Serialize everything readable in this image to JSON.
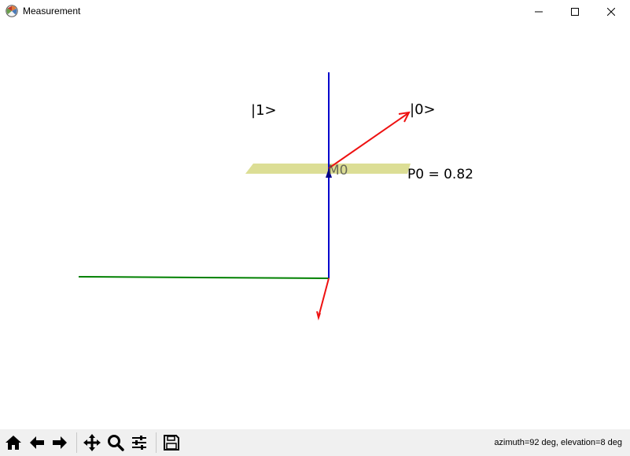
{
  "window": {
    "title": "Measurement",
    "icon": "matplotlib-icon"
  },
  "plot": {
    "labels": {
      "ket_one": "|1>",
      "ket_zero": "|0>",
      "measurement_label": "M0",
      "probability": "P0 = 0.82"
    },
    "colors": {
      "z_axis": "#0000cc",
      "x_axis": "#008000",
      "state_vector": "#ee1111",
      "measurement_plane": "#d8da8a"
    },
    "view": {
      "azimuth_deg": 92,
      "elevation_deg": 8
    }
  },
  "toolbar": {
    "buttons": [
      {
        "name": "home",
        "icon": "home-icon"
      },
      {
        "name": "back",
        "icon": "back-arrow-icon"
      },
      {
        "name": "forward",
        "icon": "forward-arrow-icon"
      },
      {
        "name": "pan",
        "icon": "pan-icon"
      },
      {
        "name": "zoom",
        "icon": "zoom-icon"
      },
      {
        "name": "configure",
        "icon": "configure-subplots-icon"
      },
      {
        "name": "save",
        "icon": "save-icon"
      }
    ],
    "status": "azimuth=92 deg, elevation=8 deg"
  }
}
